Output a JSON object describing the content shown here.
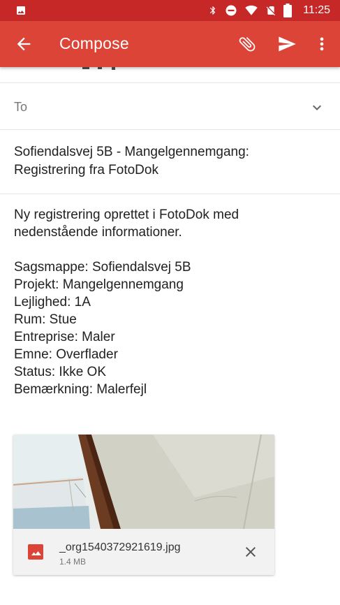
{
  "status_bar": {
    "time": "11:25"
  },
  "app_bar": {
    "title": "Compose"
  },
  "to_field": {
    "label": "To"
  },
  "subject": {
    "line1": "Sofiendalsvej 5B - Mangelgennemgang:",
    "line2": "Registrering fra FotoDok"
  },
  "body": {
    "intro_line1": "Ny registrering oprettet i FotoDok med",
    "intro_line2": "nedenstående informationer.",
    "fields": [
      "Sagsmappe: Sofiendalsvej 5B",
      "Projekt: Mangelgennemgang",
      "Lejlighed: 1A",
      "Rum: Stue",
      "Entreprise: Maler",
      "Emne: Overflader",
      "Status: Ikke OK",
      "Bemærkning: Malerfejl"
    ]
  },
  "attachment": {
    "filename": "_org1540372921619.jpg",
    "size": "1.4 MB"
  },
  "colors": {
    "app_bar": "#db4437",
    "status_bar": "#c62828",
    "attachment_icon": "#db4437"
  },
  "icons": [
    "image-icon",
    "bluetooth-icon",
    "do-not-disturb-icon",
    "wifi-icon",
    "no-sim-icon",
    "battery-icon",
    "back-arrow-icon",
    "attach-icon",
    "send-icon",
    "more-vert-icon",
    "chevron-down-icon",
    "image-file-icon",
    "close-icon"
  ]
}
